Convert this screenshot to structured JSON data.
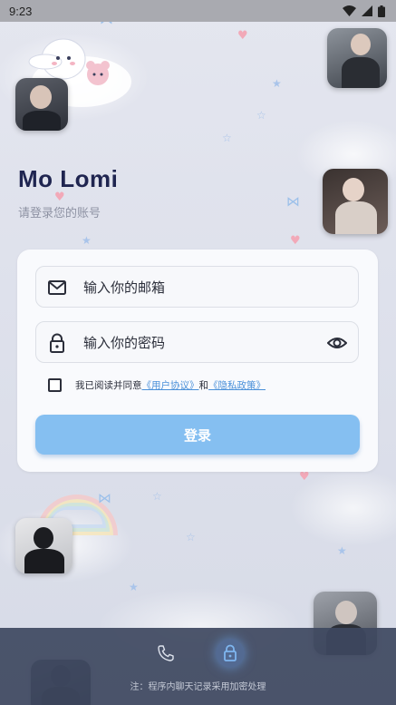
{
  "status_bar": {
    "time": "9:23"
  },
  "login": {
    "app_title": "Mo Lomi",
    "subtitle": "请登录您的账号",
    "email_placeholder": "输入你的邮箱",
    "password_placeholder": "输入你的密码",
    "agree_prefix": "我已阅读并同意",
    "user_agreement": "《用户协议》",
    "conjunction": "和",
    "privacy_policy": "《隐私政策》",
    "login_button": "登录"
  },
  "bottom_bar": {
    "note": "注：程序内聊天记录采用加密处理"
  },
  "colors": {
    "accent": "#85bff1",
    "title": "#1f2550",
    "link": "#4a90d9",
    "bottom_bar": "#3e4860"
  },
  "icons": {
    "email": "mail-icon",
    "password": "lock-icon",
    "toggle_password": "eye-icon",
    "call": "phone-icon",
    "secure": "lock-icon"
  }
}
